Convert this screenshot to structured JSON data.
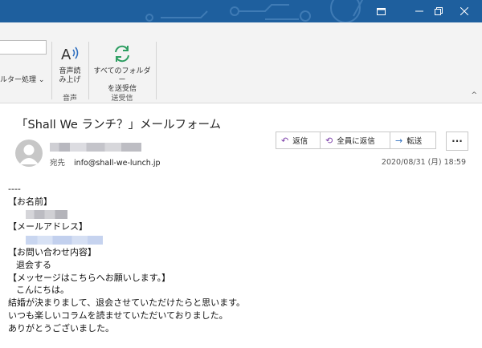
{
  "ribbon": {
    "filter_label": "ルター処理",
    "read_aloud_label_1": "音声読",
    "read_aloud_label_2": "み上げ",
    "group_voice": "音声",
    "sendrecv_label_1": "すべてのフォルダー",
    "sendrecv_label_2": "を送受信",
    "group_sendrecv": "送受信"
  },
  "message": {
    "subject": "「Shall We ランチ？」メールフォーム",
    "to_label": "宛先",
    "to_address": "info@shall-we-lunch.jp",
    "datetime": "2020/08/31 (月) 18:59"
  },
  "actions": {
    "reply": "返信",
    "reply_all": "全員に返信",
    "forward": "転送",
    "more": "···"
  },
  "body": {
    "separator": "----",
    "name_heading": "【お名前】",
    "email_heading": "【メールアドレス】",
    "inquiry_heading": "【お問い合わせ内容】",
    "inquiry_value": "退会する",
    "message_heading": "【メッセージはこちらへお願いします。】",
    "lines": [
      "こんにちは。",
      "結婚が決まりまして、退会させていただけたらと思います。",
      "いつも楽しいコラムを読ませていただいておりました。",
      "ありがとうございました。"
    ]
  },
  "colors": {
    "titlebar": "#1e5f9e",
    "accent_green": "#2e9e62",
    "accent_blue": "#2f6fbf",
    "accent_purple": "#7b3fa8"
  }
}
